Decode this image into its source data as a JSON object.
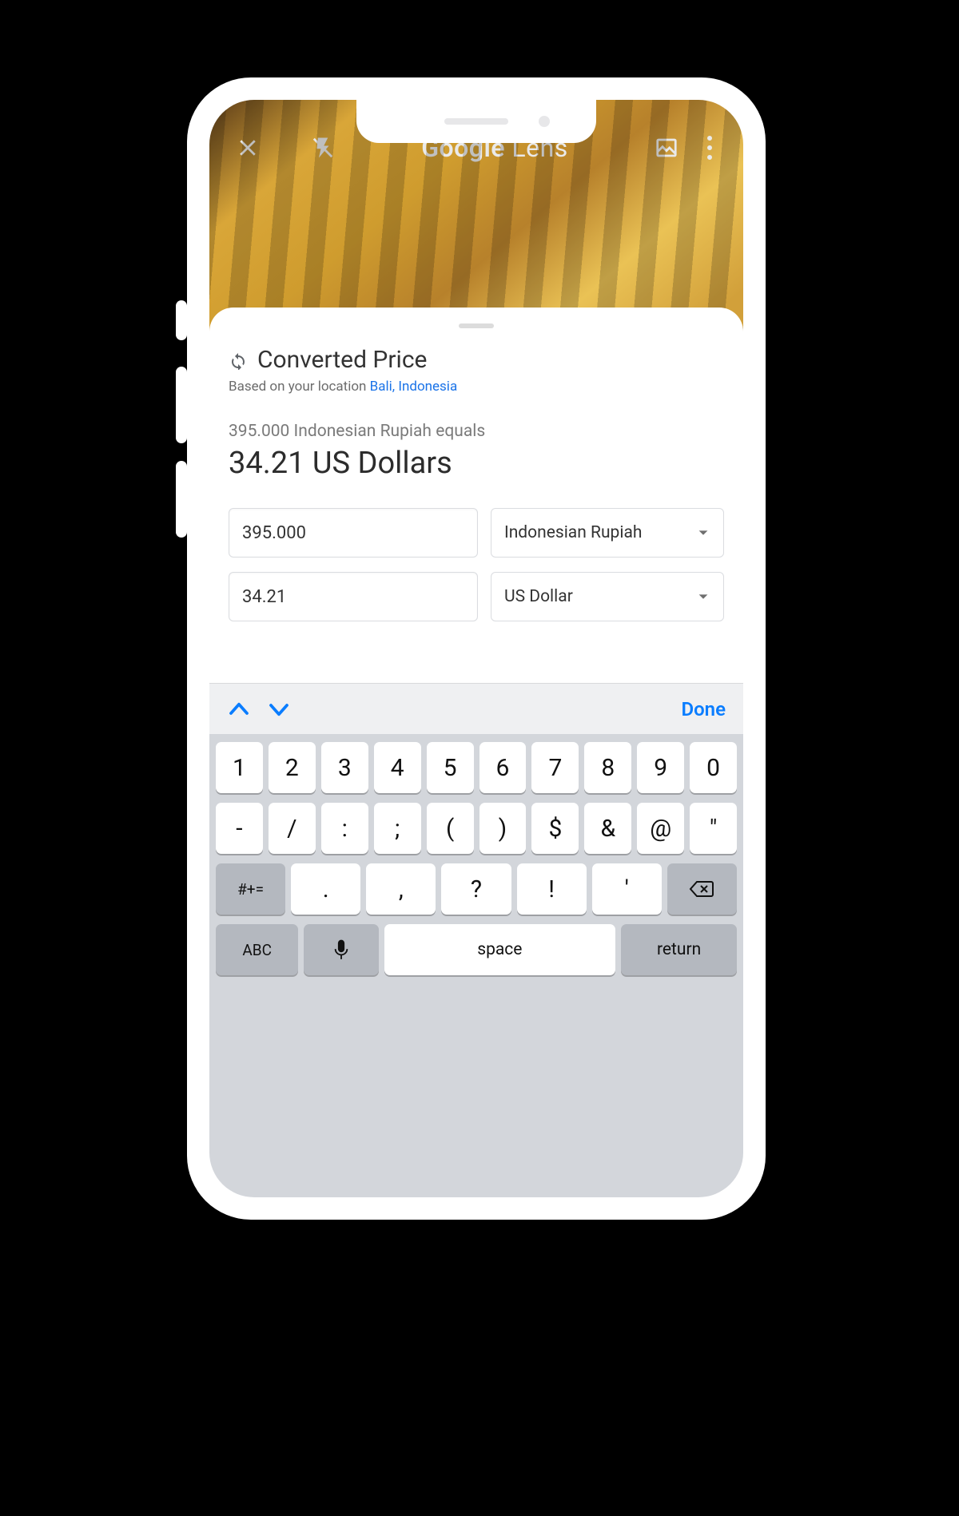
{
  "topbar": {
    "title_bold": "Google",
    "title_light": " Lens"
  },
  "card": {
    "heading": "Converted Price",
    "sub_prefix": "Based on your location ",
    "location_link": "Bali, Indonesia",
    "equals_line": "395.000 Indonesian Rupiah equals",
    "result": "34.21 US Dollars",
    "amount_from": "395.000",
    "currency_from": "Indonesian Rupiah",
    "amount_to": "34.21",
    "currency_to": "US Dollar"
  },
  "kb_accessory": {
    "done": "Done"
  },
  "keyboard": {
    "r1": [
      "1",
      "2",
      "3",
      "4",
      "5",
      "6",
      "7",
      "8",
      "9",
      "0"
    ],
    "r2": [
      "-",
      "/",
      ":",
      ";",
      "(",
      ")",
      "$",
      "&",
      "@",
      "″"
    ],
    "r3_shift": "#+=",
    "r3": [
      ".",
      ",",
      "?",
      "!",
      "′"
    ],
    "abc": "ABC",
    "space": "space",
    "return": "return"
  }
}
